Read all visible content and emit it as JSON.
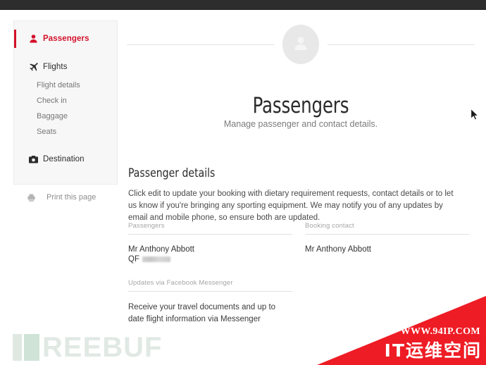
{
  "window": {
    "chrome_bar": ""
  },
  "sidebar": {
    "items": [
      {
        "label": "Passengers",
        "icon": "person-icon",
        "active": true
      },
      {
        "label": "Flights",
        "icon": "airplane-icon",
        "active": false
      },
      {
        "label": "Destination",
        "icon": "camera-icon",
        "active": false
      }
    ],
    "flight_subitems": [
      {
        "label": "Flight details"
      },
      {
        "label": "Check in"
      },
      {
        "label": "Baggage"
      },
      {
        "label": "Seats"
      }
    ],
    "print": {
      "label": "Print this page",
      "icon": "printer-icon"
    },
    "active_color": "#d4112a"
  },
  "main": {
    "avatar_icon": "person-avatar-icon",
    "title": "Passengers",
    "subtitle": "Manage passenger and contact details.",
    "section_heading": "Passenger details",
    "intro": "Click edit to update your booking with dietary requirement requests, contact details or to let us know if you're bringing any sporting equipment. We may notify you of any updates by email and mobile phone, so ensure both are updated.",
    "fields": {
      "passengers": {
        "label": "Passengers",
        "name": "Mr Anthony Abbott",
        "frequent_flyer_prefix": "QF",
        "frequent_flyer_value": ""
      },
      "booking_contact": {
        "label": "Booking contact",
        "name": "Mr Anthony Abbott"
      },
      "messenger": {
        "label": "Updates via Facebook Messenger",
        "copy": "Receive your travel documents and up to date flight information via Messenger"
      }
    }
  },
  "watermarks": {
    "freebuf": "REEBUF",
    "site_url": "WWW.94IP.COM",
    "site_name": "IT运维空间",
    "corner_color": "#ee1c25"
  }
}
